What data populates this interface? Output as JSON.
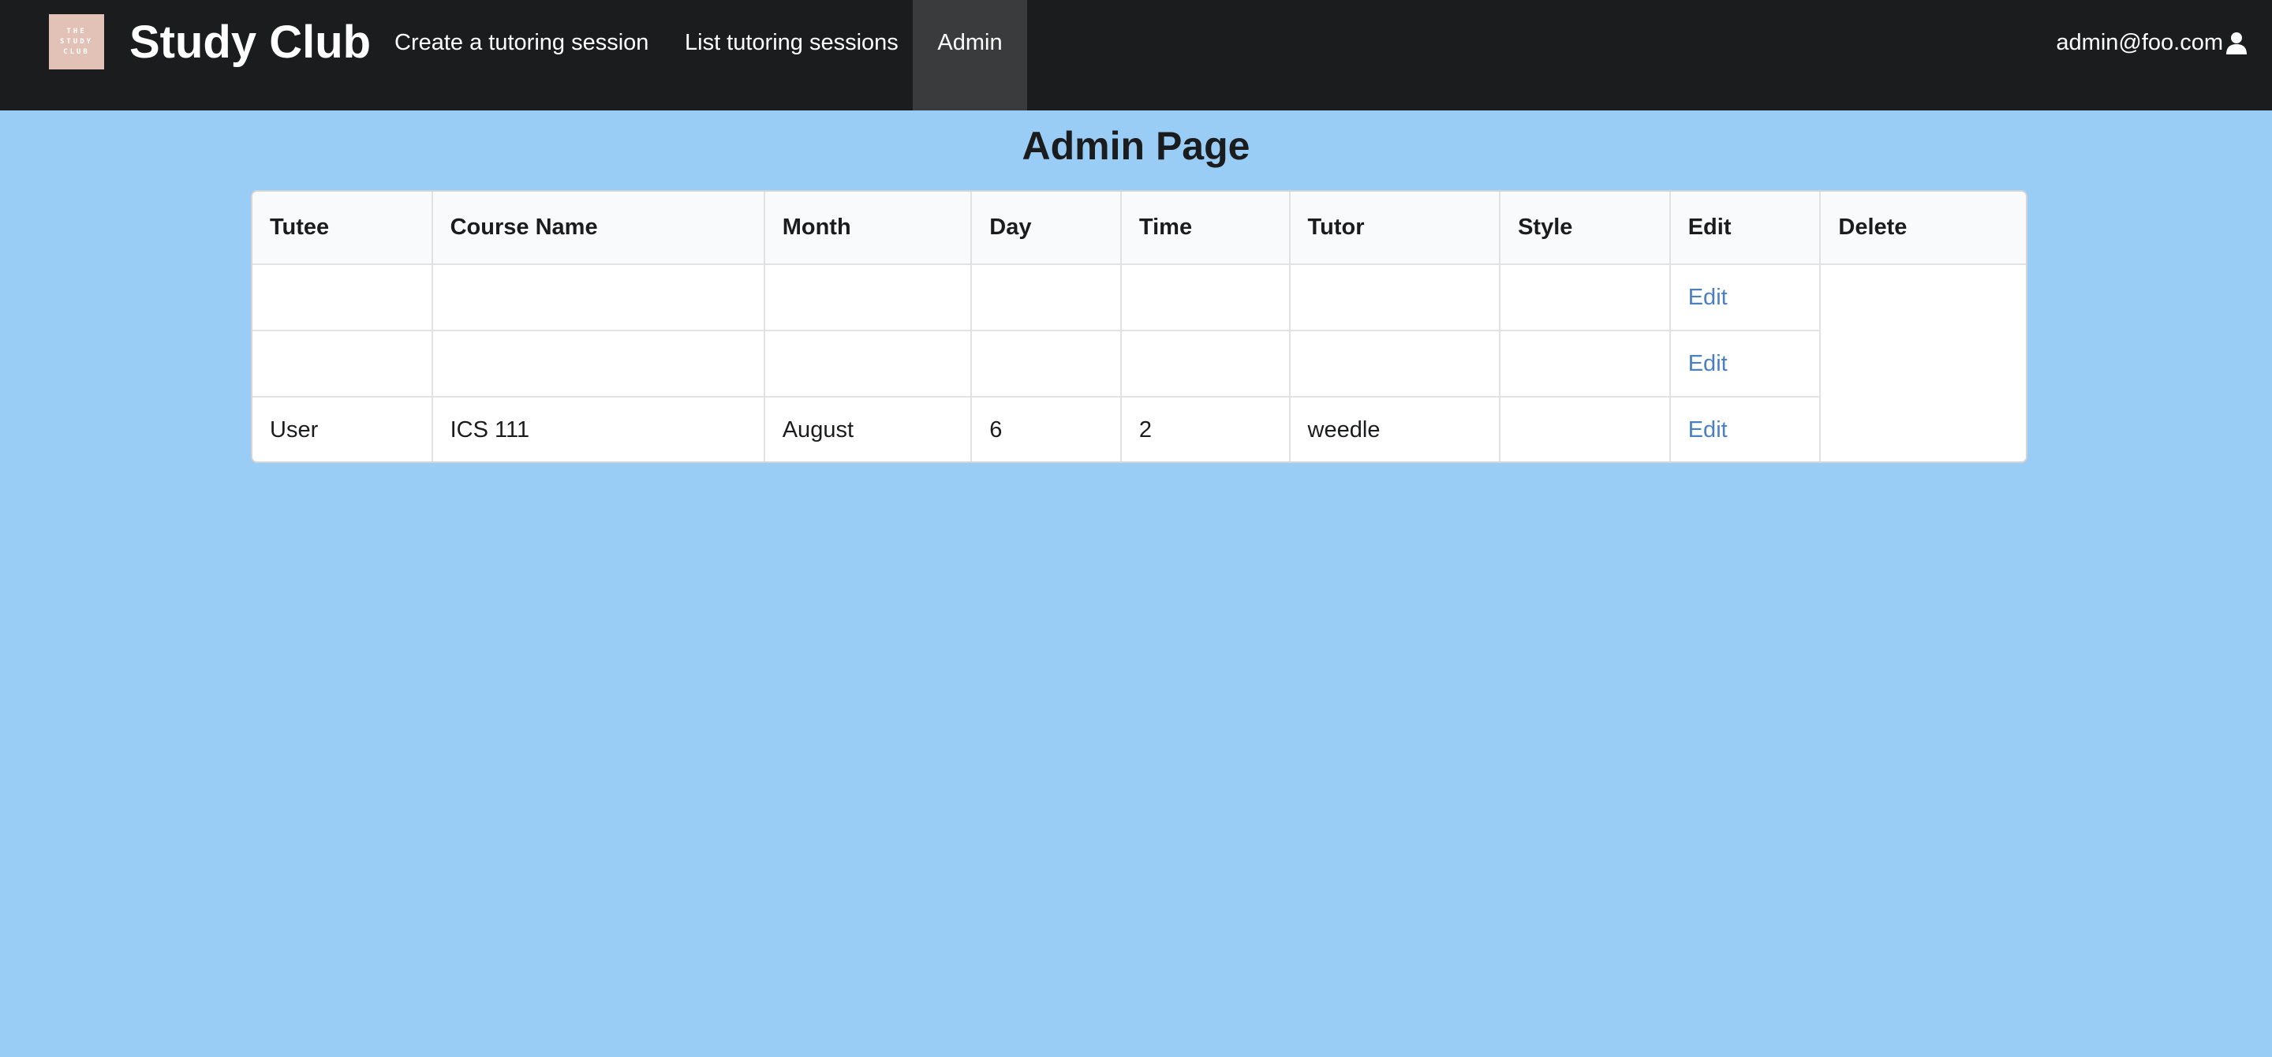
{
  "navbar": {
    "logo_text": [
      "THE",
      "STUDY",
      "CLUB"
    ],
    "brand": "Study Club",
    "items": [
      {
        "label": "Create a tutoring session"
      },
      {
        "label": "List tutoring sessions"
      },
      {
        "label": "Admin",
        "active": true
      }
    ],
    "user": "admin@foo.com",
    "user_icon": "user-icon"
  },
  "page": {
    "title": "Admin Page"
  },
  "table": {
    "columns": [
      "Tutee",
      "Course Name",
      "Month",
      "Day",
      "Time",
      "Tutor",
      "Style",
      "Edit",
      "Delete"
    ],
    "rows": [
      {
        "tutee": "",
        "course": "",
        "month": "",
        "day": "",
        "time": "",
        "tutor": "",
        "style": "",
        "edit": "Edit"
      },
      {
        "tutee": "",
        "course": "",
        "month": "",
        "day": "",
        "time": "",
        "tutor": "",
        "style": "",
        "edit": "Edit"
      },
      {
        "tutee": "User",
        "course": "ICS 111",
        "month": "August",
        "day": "6",
        "time": "2",
        "tutor": "weedle",
        "style": "",
        "edit": "Edit"
      }
    ]
  },
  "colors": {
    "navbar_bg": "#1b1c1d",
    "active_nav_bg": "#3a3b3c",
    "page_bg": "#99cdf5",
    "link": "#4a7fc1"
  }
}
